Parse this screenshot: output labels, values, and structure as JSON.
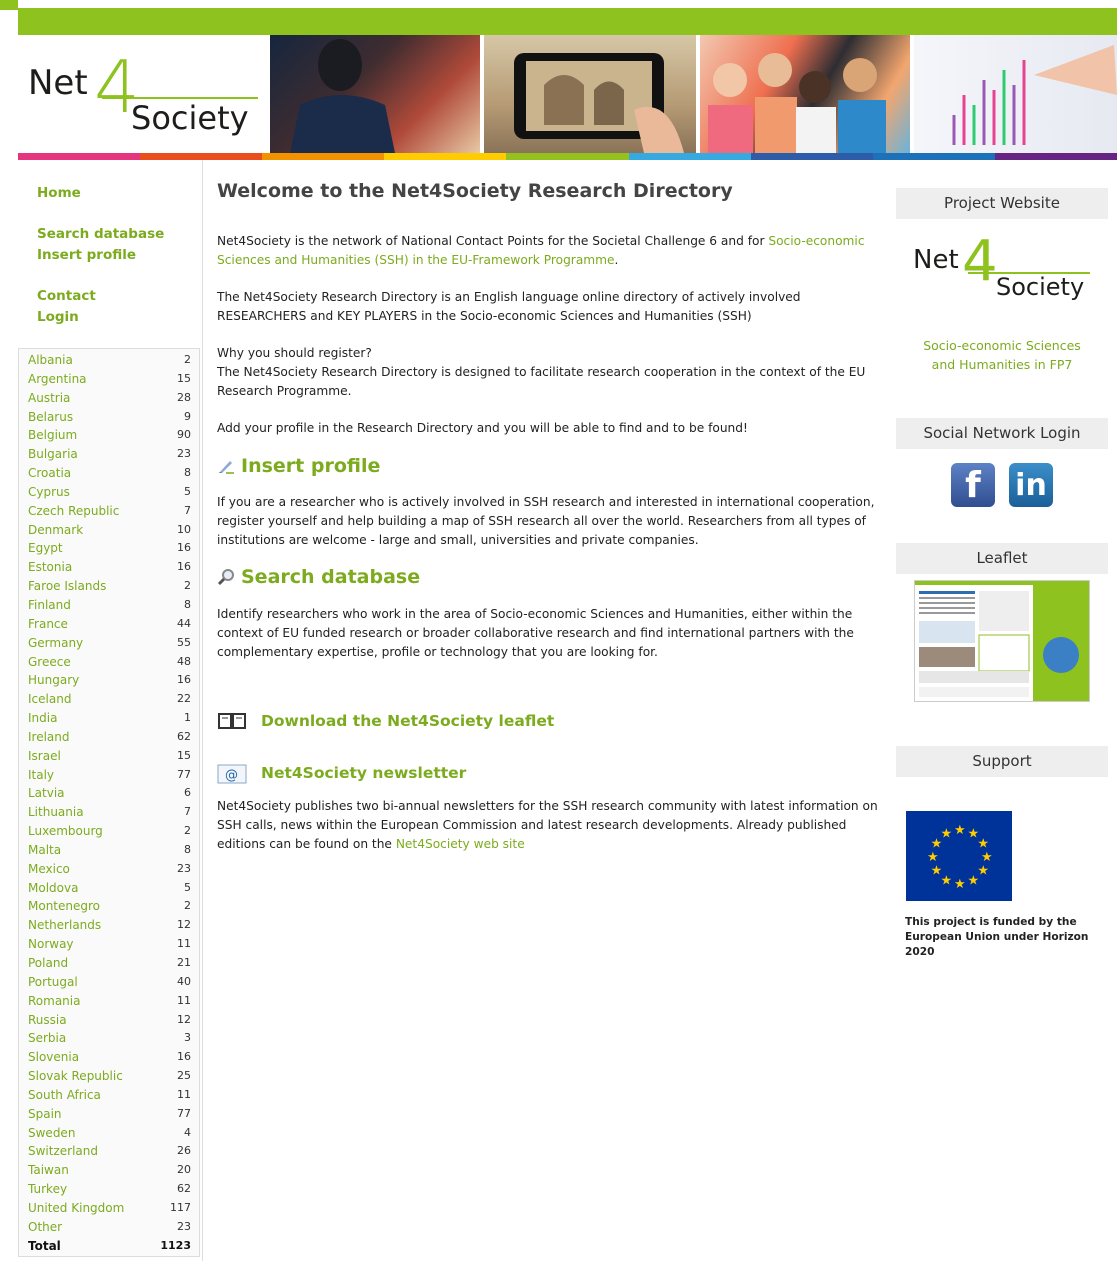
{
  "header": {
    "logo_net": "Net",
    "logo_four": "4",
    "logo_society": "Society"
  },
  "colors": {
    "accent": "#7cab1e",
    "topbar": "#8dc21f",
    "stripes": [
      "#e5357f",
      "#e94e1b",
      "#f39200",
      "#ffcc00",
      "#95c11f",
      "#36a9e1",
      "#2d5ca8",
      "#1d71b8",
      "#662483"
    ]
  },
  "nav": {
    "home": "Home",
    "search_database": "Search database",
    "insert_profile": "Insert profile",
    "contact": "Contact",
    "login": "Login"
  },
  "countries": [
    {
      "name": "Albania",
      "count": "2"
    },
    {
      "name": "Argentina",
      "count": "15"
    },
    {
      "name": "Austria",
      "count": "28"
    },
    {
      "name": "Belarus",
      "count": "9"
    },
    {
      "name": "Belgium",
      "count": "90"
    },
    {
      "name": "Bulgaria",
      "count": "23"
    },
    {
      "name": "Croatia",
      "count": "8"
    },
    {
      "name": "Cyprus",
      "count": "5"
    },
    {
      "name": "Czech Republic",
      "count": "7"
    },
    {
      "name": "Denmark",
      "count": "10"
    },
    {
      "name": "Egypt",
      "count": "16"
    },
    {
      "name": "Estonia",
      "count": "16"
    },
    {
      "name": "Faroe Islands",
      "count": "2"
    },
    {
      "name": "Finland",
      "count": "8"
    },
    {
      "name": "France",
      "count": "44"
    },
    {
      "name": "Germany",
      "count": "55"
    },
    {
      "name": "Greece",
      "count": "48"
    },
    {
      "name": "Hungary",
      "count": "16"
    },
    {
      "name": "Iceland",
      "count": "22"
    },
    {
      "name": "India",
      "count": "1"
    },
    {
      "name": "Ireland",
      "count": "62"
    },
    {
      "name": "Israel",
      "count": "15"
    },
    {
      "name": "Italy",
      "count": "77"
    },
    {
      "name": "Latvia",
      "count": "6"
    },
    {
      "name": "Lithuania",
      "count": "7"
    },
    {
      "name": "Luxembourg",
      "count": "2"
    },
    {
      "name": "Malta",
      "count": "8"
    },
    {
      "name": "Mexico",
      "count": "23"
    },
    {
      "name": "Moldova",
      "count": "5"
    },
    {
      "name": "Montenegro",
      "count": "2"
    },
    {
      "name": "Netherlands",
      "count": "12"
    },
    {
      "name": "Norway",
      "count": "11"
    },
    {
      "name": "Poland",
      "count": "21"
    },
    {
      "name": "Portugal",
      "count": "40"
    },
    {
      "name": "Romania",
      "count": "11"
    },
    {
      "name": "Russia",
      "count": "12"
    },
    {
      "name": "Serbia",
      "count": "3"
    },
    {
      "name": "Slovenia",
      "count": "16"
    },
    {
      "name": "Slovak Republic",
      "count": "25"
    },
    {
      "name": "South Africa",
      "count": "11"
    },
    {
      "name": "Spain",
      "count": "77"
    },
    {
      "name": "Sweden",
      "count": "4"
    },
    {
      "name": "Switzerland",
      "count": "26"
    },
    {
      "name": "Taiwan",
      "count": "20"
    },
    {
      "name": "Turkey",
      "count": "62"
    },
    {
      "name": "United Kingdom",
      "count": "117"
    },
    {
      "name": "Other",
      "count": "23"
    }
  ],
  "total": {
    "label": "Total",
    "count": "1123"
  },
  "main": {
    "title": "Welcome to the Net4Society Research Directory",
    "intro_text": "Net4Society is the network of National Contact Points for the Societal Challenge 6 and for ",
    "intro_link": "Socio-economic Sciences and Humanities (SSH) in the EU-Framework Programme",
    "intro_end": ".",
    "directory_text": "The Net4Society Research Directory is an English language online directory of actively involved RESEARCHERS and KEY PLAYERS in the Socio-economic Sciences and Humanities (SSH)",
    "why_heading": "Why you should register?",
    "why_text": "The Net4Society Research Directory is designed to facilitate research cooperation in the context of the EU Research Programme.",
    "add_text": "Add your profile in the Research Directory and you will be able to find and to be found!",
    "insert_title": "Insert profile",
    "insert_text": "If you are a researcher who is actively involved in SSH research and interested in international cooperation, register yourself and help building a map of SSH research all over the world. Researchers from all types of institutions are welcome - large and small, universities and private companies.",
    "search_title": "Search database",
    "search_text": "Identify researchers who work in the area of Socio-economic Sciences and Humanities, either within the context of EU funded research or broader collaborative research and find international partners with the complementary expertise, profile or technology that you are looking for.",
    "download_link": "Download the Net4Society leaflet",
    "newsletter_title": "Net4Society newsletter",
    "newsletter_text": "Net4Society publishes two bi-annual newsletters for the SSH research community with latest information on SSH calls, news within the European Commission and latest research developments. Already published editions can be found on the ",
    "newsletter_link": "Net4Society web site"
  },
  "right": {
    "project_website": "Project Website",
    "fp7_text": "Socio-economic Sciences and Humanities in FP7",
    "social_login": "Social Network Login",
    "fb_letter": "f",
    "li_letters": "in",
    "leaflet": "Leaflet",
    "support": "Support",
    "eu_text": "This project is funded by the European Union under Horizon 2020"
  },
  "icons": {
    "insert": "pencil-icon",
    "search": "magnifier-icon",
    "download": "book-icon",
    "newsletter": "email-icon"
  }
}
